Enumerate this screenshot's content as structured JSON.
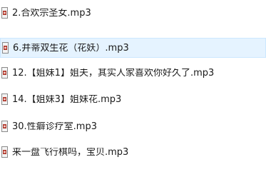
{
  "files": [
    {
      "name": "2.合欢宗圣女.mp3",
      "icon": "audio-file-icon",
      "selected": false
    },
    {
      "name": "6.并蒂双生花（花妖）.mp3",
      "icon": "audio-file-icon",
      "selected": true
    },
    {
      "name": "12.【姐妹1】姐夫，其实人家喜欢你好久了.mp3",
      "icon": "audio-file-icon",
      "selected": false
    },
    {
      "name": "14.【姐妹3】姐妹花.mp3",
      "icon": "audio-file-icon",
      "selected": false
    },
    {
      "name": "30.性癖诊疗室.mp3",
      "icon": "audio-file-icon",
      "selected": false
    },
    {
      "name": "来一盘飞行棋吗，宝贝.mp3",
      "icon": "audio-file-icon",
      "selected": false
    }
  ],
  "colors": {
    "selected_bg": "#e5f3ff",
    "selected_border": "#cce8ff",
    "text": "#1a1a1a"
  }
}
